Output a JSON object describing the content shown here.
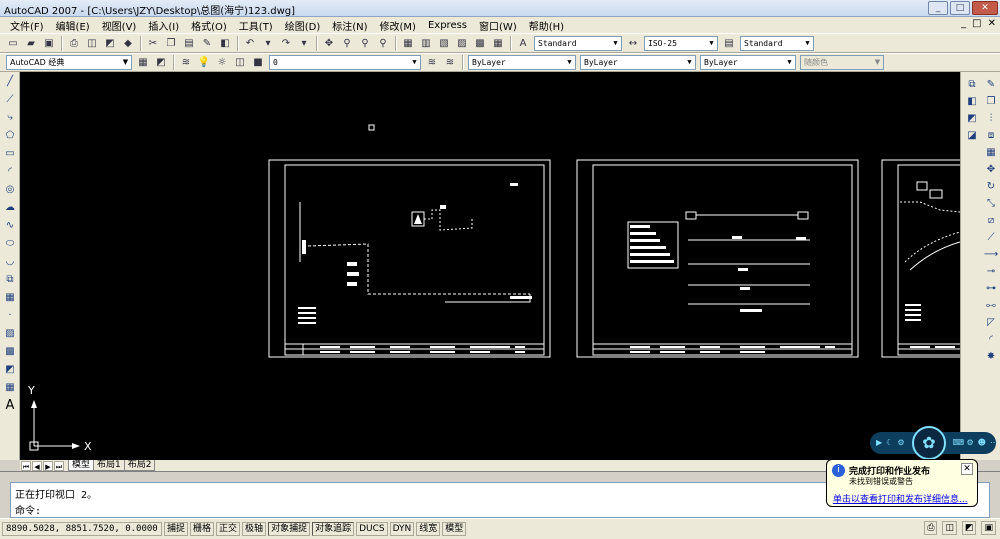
{
  "window": {
    "title": "AutoCAD 2007 - [C:\\Users\\JZY\\Desktop\\总图(海宁)123.dwg]",
    "minimize": "_",
    "maximize": "□",
    "close": "✕"
  },
  "menu": {
    "items": [
      "文件(F)",
      "编辑(E)",
      "视图(V)",
      "插入(I)",
      "格式(O)",
      "工具(T)",
      "绘图(D)",
      "标注(N)",
      "修改(M)",
      "Express",
      "窗口(W)",
      "帮助(H)"
    ],
    "doc_controls": [
      "_",
      "□",
      "✕"
    ]
  },
  "toolbar": {
    "text_style": "Standard",
    "dim_style": "ISO-25",
    "table_style": "Standard",
    "workspace": "AutoCAD 经典",
    "layer": "0",
    "color": "ByLayer",
    "linetype": "ByLayer",
    "lineweight": "ByLayer",
    "plot_style": "随颜色"
  },
  "ucs": {
    "x_label": "X",
    "y_label": "Y"
  },
  "layout_tabs": [
    "模型",
    "布局1",
    "布局2"
  ],
  "command": {
    "history": "正在打印视口 2。",
    "prompt": "命令:"
  },
  "status": {
    "coords": "8890.5028, 8851.7520, 0.0000",
    "buttons": [
      "捕捉",
      "栅格",
      "正交",
      "极轴",
      "对象捕捉",
      "对象追踪",
      "DUCS",
      "DYN",
      "线宽",
      "模型"
    ]
  },
  "notification": {
    "title": "完成打印和作业发布",
    "subtitle": "未找到错误或警告",
    "link": "单击以查看打印和发布详细信息..."
  },
  "colors": {
    "canvas": "#000000",
    "toolbar": "#ece9d8",
    "notify_bg": "#ffffe1"
  }
}
